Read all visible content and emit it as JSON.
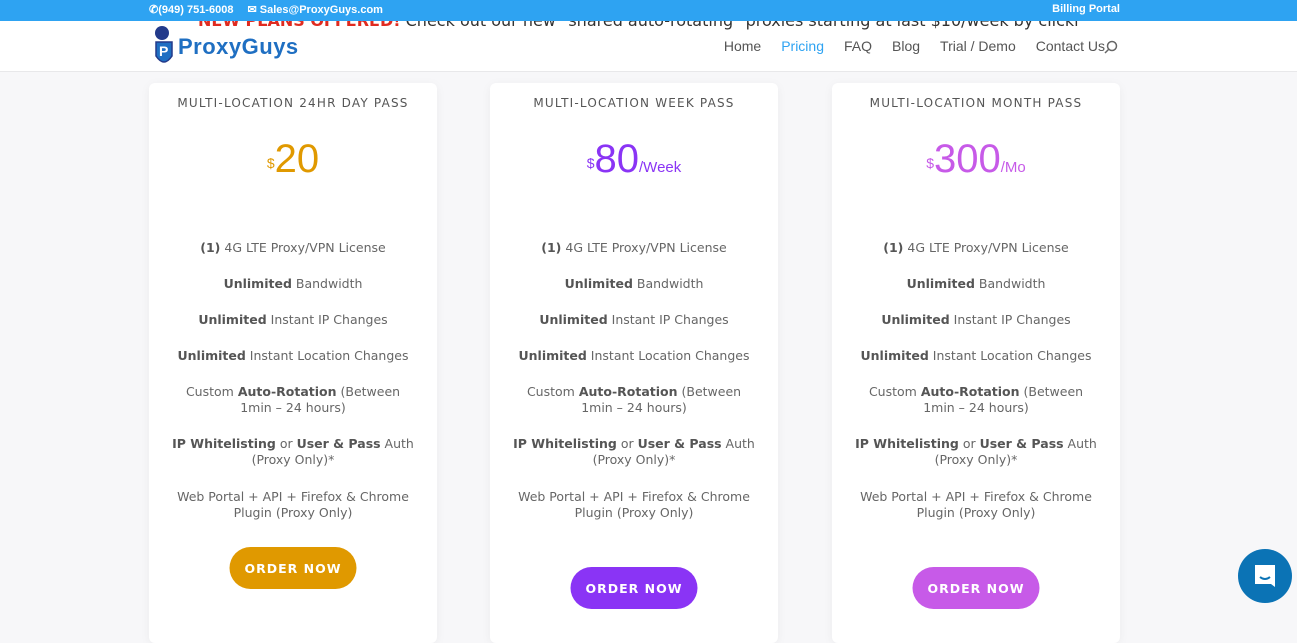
{
  "topbar": {
    "phone": "(949) 751-6008",
    "email": "Sales@ProxyGuys.com",
    "billing": "Billing Portal"
  },
  "announcement": {
    "highlight": "NEW PLANS OFFERED!",
    "text": " Check out our new \"shared auto-rotating\" proxies starting at last $10/week by clicking HERE"
  },
  "logo": {
    "text": "ProxyGuys"
  },
  "nav": [
    {
      "label": "Home"
    },
    {
      "label": "Pricing",
      "active": true
    },
    {
      "label": "FAQ"
    },
    {
      "label": "Blog"
    },
    {
      "label": "Trial / Demo"
    },
    {
      "label": "Contact Us"
    }
  ],
  "plans": [
    {
      "title": "MULTI-LOCATION 24HR DAY PASS",
      "currency": "$",
      "amount": "20",
      "period": "",
      "color": "#e09900",
      "button": "ORDER NOW"
    },
    {
      "title": "MULTI-LOCATION WEEK PASS",
      "currency": "$",
      "amount": "80",
      "period": "/Week",
      "color": "#8a34f5",
      "button": "ORDER NOW"
    },
    {
      "title": "MULTI-LOCATION MONTH PASS",
      "currency": "$",
      "amount": "300",
      "period": "/Mo",
      "color": "#c75ae8",
      "button": "ORDER NOW"
    }
  ],
  "features": [
    [
      {
        "t": "(1)",
        "b": true
      },
      {
        "t": " 4G LTE Proxy/VPN License"
      }
    ],
    [
      {
        "t": "Unlimited",
        "b": true
      },
      {
        "t": " Bandwidth"
      }
    ],
    [
      {
        "t": "Unlimited",
        "b": true
      },
      {
        "t": " Instant IP Changes"
      }
    ],
    [
      {
        "t": "Unlimited",
        "b": true
      },
      {
        "t": " Instant Location Changes"
      }
    ],
    [
      {
        "t": "Custom "
      },
      {
        "t": "Auto-Rotation",
        "b": true
      },
      {
        "t": " (Between 1min – 24 hours)"
      }
    ],
    [
      {
        "t": "IP Whitelisting",
        "b": true
      },
      {
        "t": " or "
      },
      {
        "t": "User & Pass",
        "b": true
      },
      {
        "t": " Auth (Proxy Only)*"
      }
    ],
    [
      {
        "t": "Web Portal + API + Firefox & Chrome Plugin (Proxy Only)"
      }
    ]
  ]
}
